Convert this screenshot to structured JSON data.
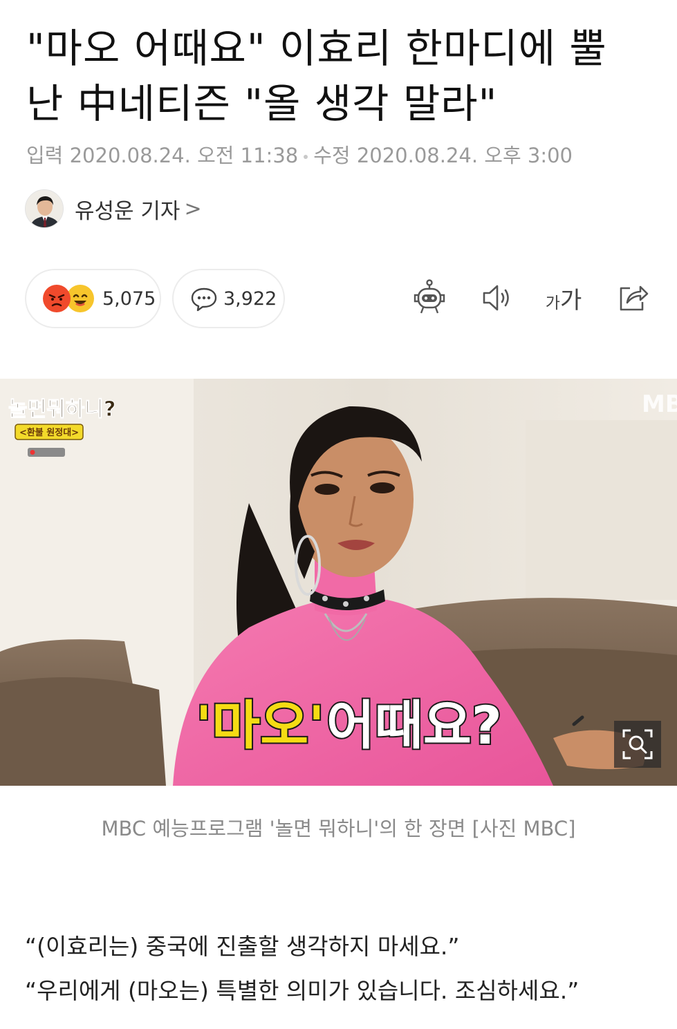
{
  "article": {
    "headline_line1": "\"마오 어때요\" 이효리 한마디에 뿔",
    "headline_line2": "난 中네티즌 \"올 생각 말라\"",
    "input_label": "입력",
    "input_time": "2020.08.24. 오전 11:38",
    "edit_label": "수정",
    "edit_time": "2020.08.24. 오후 3:00",
    "author_name": "유성운 기자",
    "author_chevron": ">"
  },
  "actions": {
    "reaction_count": "5,075",
    "comment_count": "3,922",
    "font_small": "가",
    "font_large": "가",
    "icons": [
      "angry-emoji-icon",
      "laugh-emoji-icon",
      "comment-bubble-icon",
      "robot-summary-icon",
      "speaker-icon",
      "font-size-icon",
      "share-icon"
    ]
  },
  "photo": {
    "show_title": "놀면뭐하니?",
    "show_subtitle": "<환불 원정대>",
    "broadcaster": "MBC",
    "subtitle_quoted": "'마오'",
    "subtitle_rest": "어때요?",
    "caption": "MBC 예능프로그램 '놀면 뭐하니'의 한 장면 [사진 MBC]"
  },
  "body": {
    "line1": "“(이효리는) 중국에 진출할 생각하지 마세요.”",
    "line2": "“우리에게 (마오는) 특별한 의미가 있습니다. 조심하세요.”"
  },
  "colors": {
    "meta_gray": "#9a9a9a",
    "border_gray": "#ececec",
    "subtitle_yellow": "#f5dc14",
    "sweater_pink": "#f26aa6"
  }
}
